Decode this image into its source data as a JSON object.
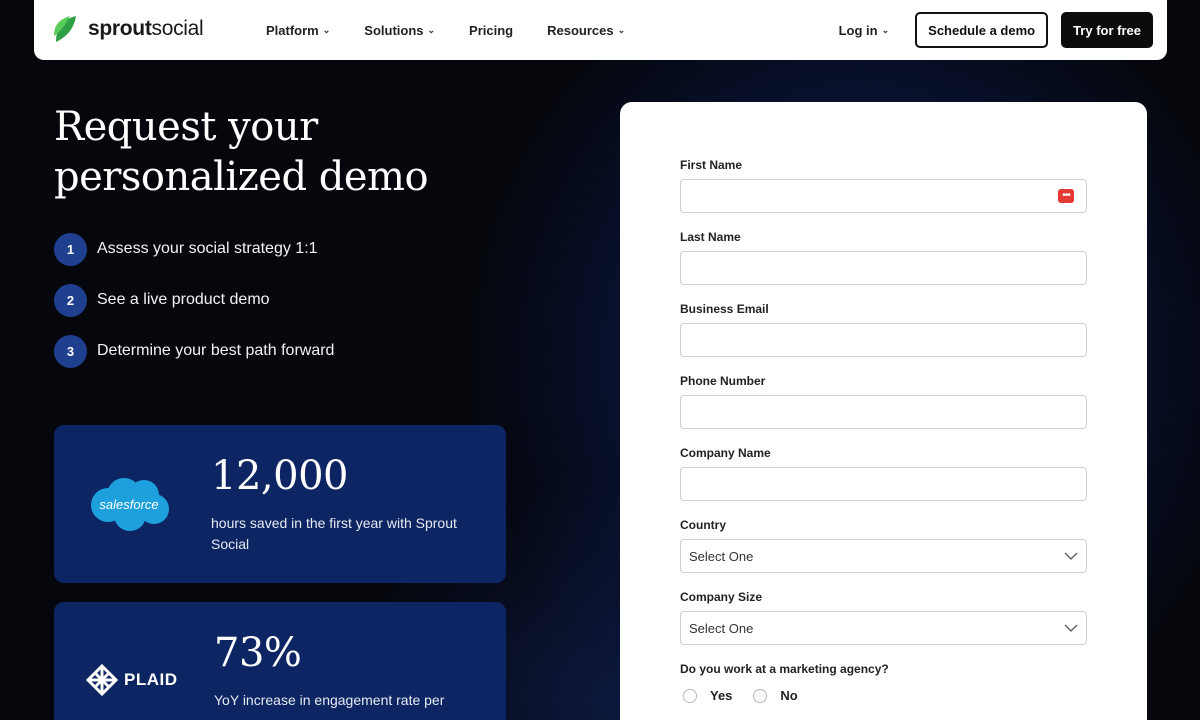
{
  "header": {
    "brand": {
      "bold": "sprout",
      "light": "social"
    },
    "nav": [
      {
        "label": "Platform",
        "has_dropdown": true
      },
      {
        "label": "Solutions",
        "has_dropdown": true
      },
      {
        "label": "Pricing",
        "has_dropdown": false
      },
      {
        "label": "Resources",
        "has_dropdown": true
      }
    ],
    "login_label": "Log in",
    "schedule_demo_label": "Schedule a demo",
    "try_free_label": "Try for free"
  },
  "hero": {
    "title_line1": "Request your",
    "title_line2": "personalized demo",
    "steps": [
      {
        "num": "1",
        "text": "Assess your social strategy 1:1"
      },
      {
        "num": "2",
        "text": "See a live product demo"
      },
      {
        "num": "3",
        "text": "Determine your best path forward"
      }
    ]
  },
  "stats": [
    {
      "logo": "salesforce",
      "logo_text": "salesforce",
      "value": "12,000",
      "desc": "hours saved in the first year with Sprout Social"
    },
    {
      "logo": "plaid",
      "logo_text": "PLAID",
      "value": "73%",
      "desc": "YoY increase in engagement rate per"
    }
  ],
  "form": {
    "fields": [
      {
        "label": "First Name",
        "value": ""
      },
      {
        "label": "Last Name",
        "value": ""
      },
      {
        "label": "Business Email",
        "value": ""
      },
      {
        "label": "Phone Number",
        "value": ""
      },
      {
        "label": "Company Name",
        "value": ""
      }
    ],
    "country": {
      "label": "Country",
      "selected": "Select One"
    },
    "company_size": {
      "label": "Company Size",
      "selected": "Select One"
    },
    "agency_question": "Do you work at a marketing agency?",
    "agency_options": [
      "Yes",
      "No"
    ]
  },
  "colors": {
    "brand_green": "#59cb59",
    "card_blue": "#0d2663",
    "step_blue": "#1f3f8f",
    "salesforce_blue": "#1ea0dd",
    "password_icon_red": "#e53935"
  }
}
